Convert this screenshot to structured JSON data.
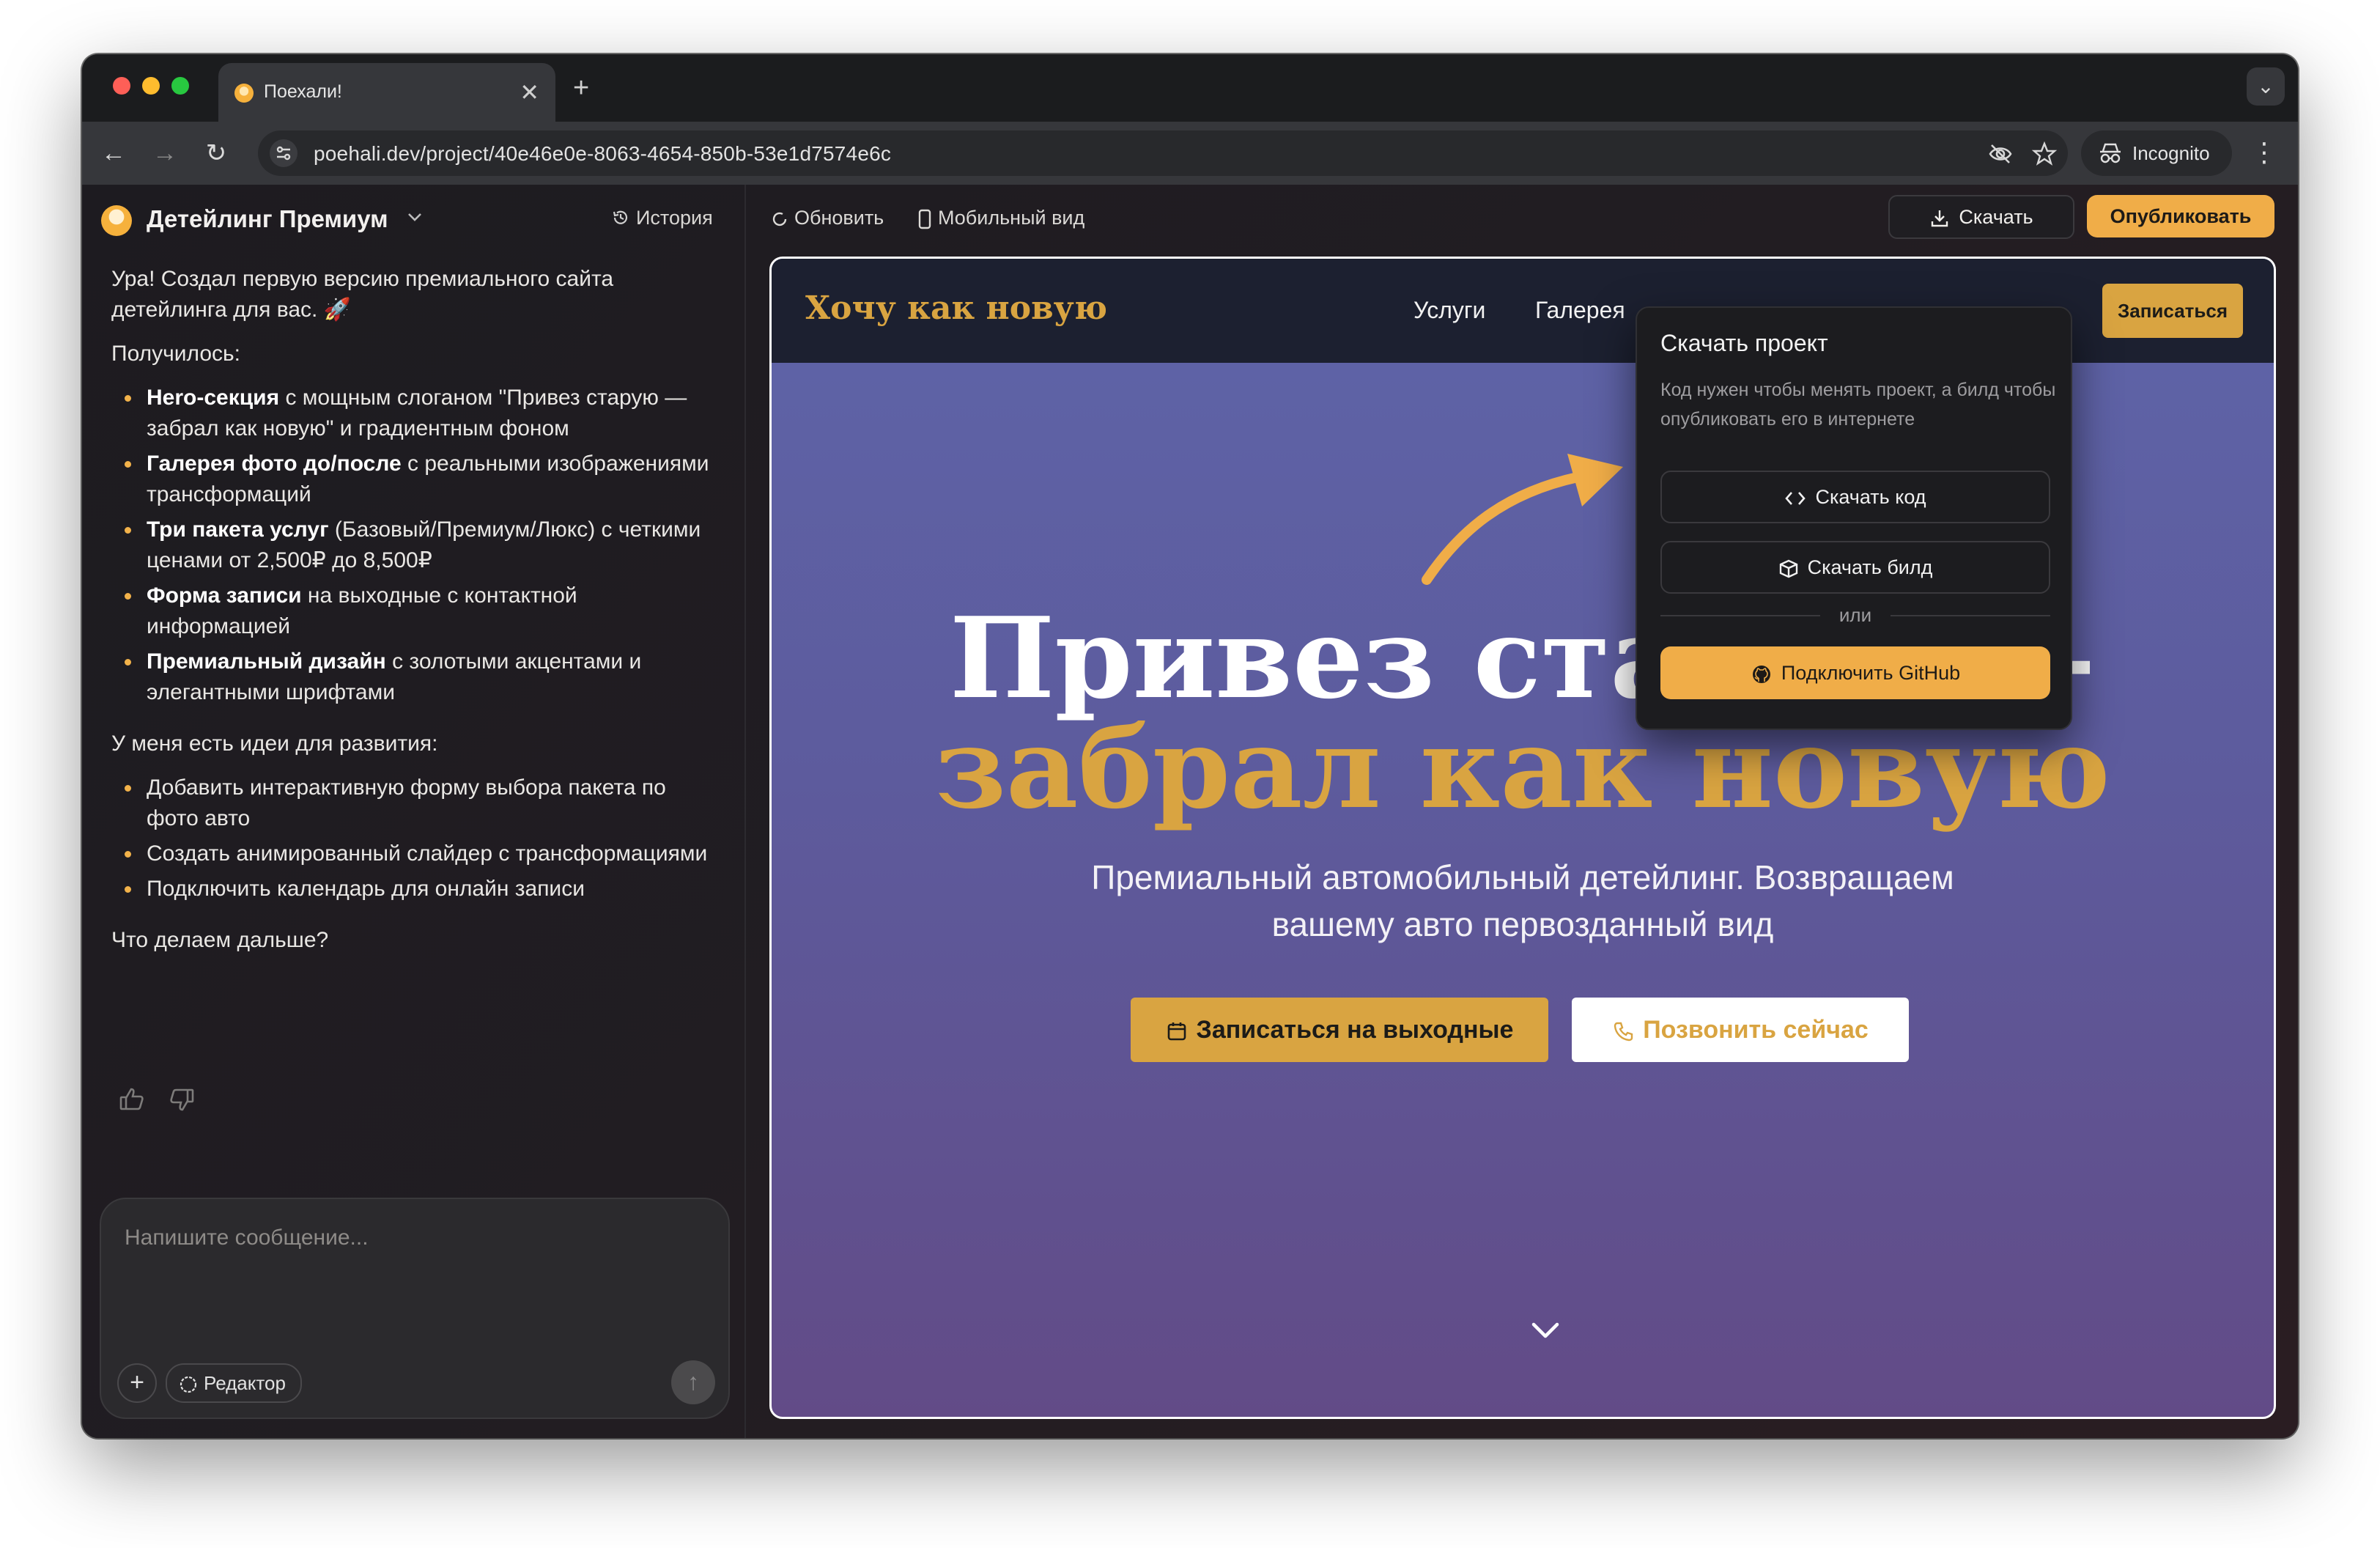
{
  "browser": {
    "tab_title": "Поехали!",
    "url": "poehali.dev/project/40e46e0e-8063-4654-850b-53e1d7574e6c",
    "incognito_label": "Incognito"
  },
  "project": {
    "name": "Детейлинг Премиум",
    "history_label": "История"
  },
  "chat": {
    "intro": "Ура! Создал первую версию премиального сайта детейлинга для вас. 🚀",
    "done_heading": "Получилось:",
    "done_items": [
      {
        "bold": "Hero-секция",
        "text": " с мощным слоганом \"Привез старую — забрал как новую\" и градиентным фоном"
      },
      {
        "bold": "Галерея фото до/после",
        "text": " с реальными изображениями трансформаций"
      },
      {
        "bold": "Три пакета услуг",
        "text": " (Базовый/Премиум/Люкс) с четкими ценами от 2,500₽ до 8,500₽"
      },
      {
        "bold": "Форма записи",
        "text": " на выходные с контактной информацией"
      },
      {
        "bold": "Премиальный дизайн",
        "text": " с золотыми акцентами и элегантными шрифтами"
      }
    ],
    "ideas_heading": "У меня есть идеи для развития:",
    "ideas_items": [
      "Добавить интерактивную форму выбора пакета по фото авто",
      "Создать анимированный слайдер с трансформациями",
      "Подключить календарь для онлайн записи"
    ],
    "question": "Что делаем дальше?"
  },
  "composer": {
    "placeholder": "Напишите сообщение...",
    "editor_label": "Редактор"
  },
  "topbar": {
    "refresh_label": "Обновить",
    "mobile_label": "Мобильный вид",
    "download_label": "Скачать",
    "publish_label": "Опубликовать"
  },
  "site": {
    "logo": "Хочу как новую",
    "nav": [
      "Услуги",
      "Галерея"
    ],
    "nav_cta": "Записаться",
    "hero_line1": "Привез старую —",
    "hero_line2": "забрал как новую",
    "hero_sub_line1": "Премиальный автомобильный детейлинг. Возвращаем",
    "hero_sub_line2": "вашему авто первозданный вид",
    "btn_primary": "Записаться на выходные",
    "btn_secondary": "Позвонить сейчас"
  },
  "download_menu": {
    "title": "Скачать проект",
    "description": "Код нужен чтобы менять проект, а билд чтобы опубликовать его в интернете",
    "download_code": "Скачать код",
    "download_build": "Скачать билд",
    "or": "или",
    "connect_github": "Подключить GitHub"
  },
  "colors": {
    "accent": "#f0ad48",
    "gold": "#d9a441",
    "hero_gradient_top": "#5e64a8",
    "hero_gradient_bottom": "#624b87"
  }
}
